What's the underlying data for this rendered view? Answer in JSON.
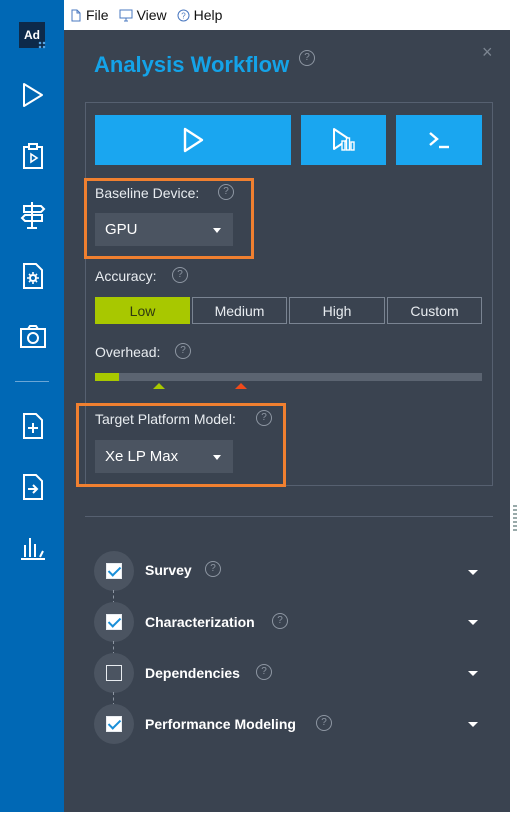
{
  "menu": {
    "file": "File",
    "view": "View",
    "help": "Help"
  },
  "sidebar": {
    "logo_text": "Ad",
    "items": [
      {
        "icon": "play-icon"
      },
      {
        "icon": "clipboard-play-icon"
      },
      {
        "icon": "signpost-icon"
      },
      {
        "icon": "settings-document-icon"
      },
      {
        "icon": "camera-icon"
      },
      {
        "icon": "new-project-icon"
      },
      {
        "icon": "open-result-icon"
      },
      {
        "icon": "bar-chart-icon"
      }
    ]
  },
  "panel": {
    "title": "Analysis Workflow",
    "help_glyph": "?",
    "close_glyph": "×"
  },
  "config": {
    "baseline_label": "Baseline Device:",
    "baseline_value": "GPU",
    "accuracy_label": "Accuracy:",
    "accuracy_options": [
      "Low",
      "Medium",
      "High",
      "Custom"
    ],
    "accuracy_selected": "Low",
    "overhead_label": "Overhead:",
    "target_label": "Target Platform Model:",
    "target_value": "Xe LP Max"
  },
  "steps": [
    {
      "label": "Survey",
      "checked": true
    },
    {
      "label": "Characterization",
      "checked": true
    },
    {
      "label": "Dependencies",
      "checked": false
    },
    {
      "label": "Performance Modeling",
      "checked": true
    }
  ],
  "colors": {
    "accent": "#1aa6f0",
    "title": "#14a3e8",
    "selected": "#a8c800",
    "highlight": "#f08030",
    "panel_bg": "#3a4350",
    "sidebar_bg": "#0068b5",
    "marker_low": "#a8c800",
    "marker_high": "#f04a1a"
  }
}
